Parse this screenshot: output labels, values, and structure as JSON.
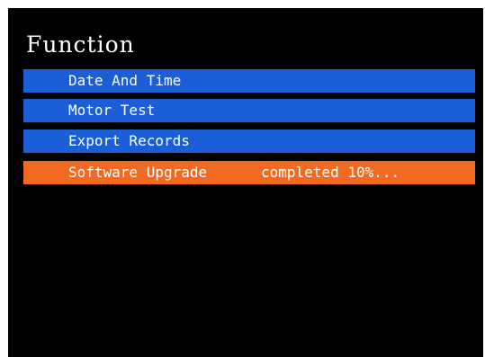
{
  "title": "Function",
  "colors": {
    "background": "#000000",
    "item": "#1a5fd6",
    "selected": "#f26a21",
    "text": "#ffffff"
  },
  "menu": {
    "items": [
      {
        "label": "Date And Time",
        "status": "",
        "selected": false
      },
      {
        "label": "Motor Test",
        "status": "",
        "selected": false
      },
      {
        "label": "Export Records",
        "status": "",
        "selected": false
      },
      {
        "label": "Software Upgrade",
        "status": "completed 10%...",
        "selected": true
      }
    ]
  }
}
